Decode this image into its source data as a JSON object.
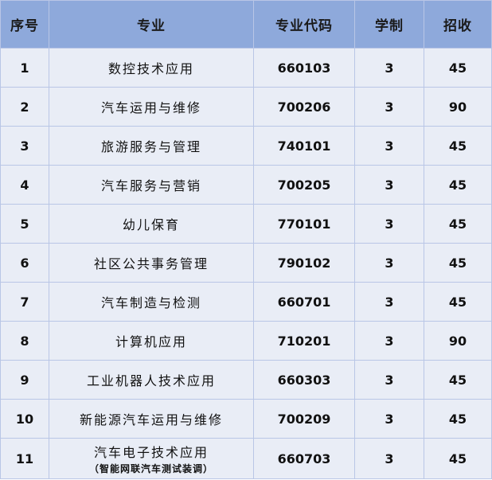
{
  "headers": [
    "序号",
    "专业",
    "专业代码",
    "学制",
    "招收"
  ],
  "rows": [
    {
      "no": "1",
      "major": "数控技术应用",
      "sub": "",
      "code": "660103",
      "years": "3",
      "enroll": "45"
    },
    {
      "no": "2",
      "major": "汽车运用与维修",
      "sub": "",
      "code": "700206",
      "years": "3",
      "enroll": "90"
    },
    {
      "no": "3",
      "major": "旅游服务与管理",
      "sub": "",
      "code": "740101",
      "years": "3",
      "enroll": "45"
    },
    {
      "no": "4",
      "major": "汽车服务与营销",
      "sub": "",
      "code": "700205",
      "years": "3",
      "enroll": "45"
    },
    {
      "no": "5",
      "major": "幼儿保育",
      "sub": "",
      "code": "770101",
      "years": "3",
      "enroll": "45"
    },
    {
      "no": "6",
      "major": "社区公共事务管理",
      "sub": "",
      "code": "790102",
      "years": "3",
      "enroll": "45"
    },
    {
      "no": "7",
      "major": "汽车制造与检测",
      "sub": "",
      "code": "660701",
      "years": "3",
      "enroll": "45"
    },
    {
      "no": "8",
      "major": "计算机应用",
      "sub": "",
      "code": "710201",
      "years": "3",
      "enroll": "90"
    },
    {
      "no": "9",
      "major": "工业机器人技术应用",
      "sub": "",
      "code": "660303",
      "years": "3",
      "enroll": "45"
    },
    {
      "no": "10",
      "major": "新能源汽车运用与维修",
      "sub": "",
      "code": "700209",
      "years": "3",
      "enroll": "45"
    },
    {
      "no": "11",
      "major": "汽车电子技术应用",
      "sub": "（智能网联汽车测试装调）",
      "code": "660703",
      "years": "3",
      "enroll": "45"
    }
  ]
}
